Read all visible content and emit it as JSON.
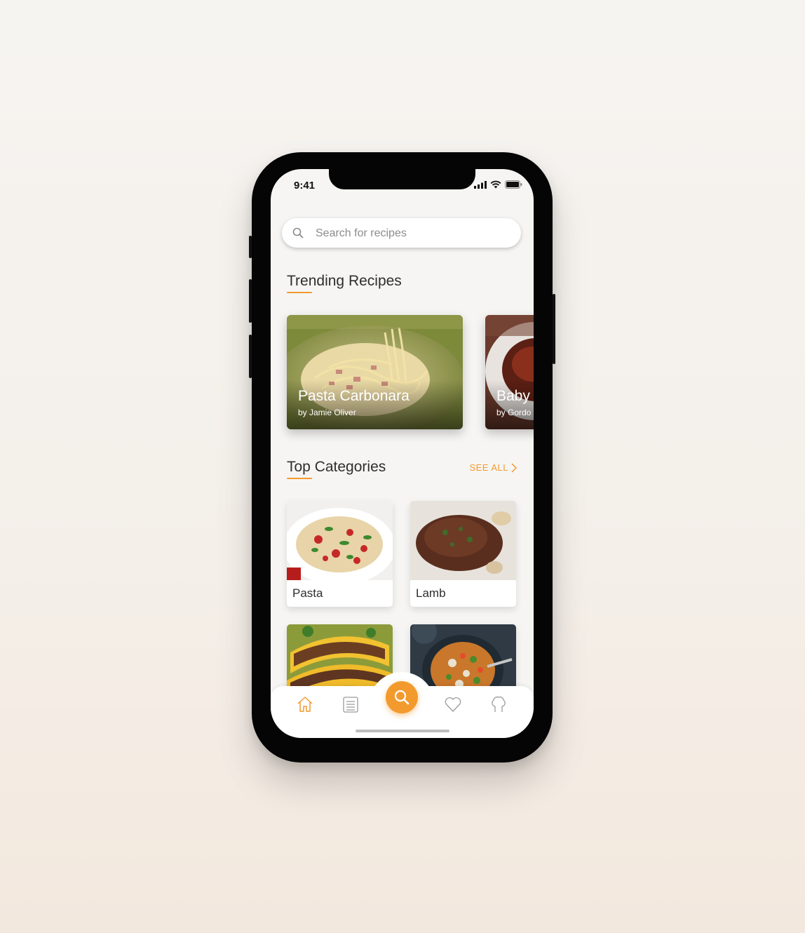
{
  "status_bar": {
    "time": "9:41"
  },
  "search": {
    "placeholder": "Search for recipes"
  },
  "trending": {
    "title": "Trending Recipes",
    "cards": [
      {
        "title": "Pasta Carbonara",
        "author": "by Jamie Oliver"
      },
      {
        "title": "Baby",
        "author": "by Gordo"
      }
    ]
  },
  "categories": {
    "title": "Top Categories",
    "see_all": "SEE ALL",
    "items": [
      {
        "label": "Pasta"
      },
      {
        "label": "Lamb"
      },
      {
        "label": ""
      },
      {
        "label": ""
      }
    ]
  },
  "tab_bar": {
    "items": [
      "home-icon",
      "list-icon",
      "search-icon",
      "heart-icon",
      "chef-hat-icon"
    ],
    "active": "search-icon"
  },
  "colors": {
    "accent": "#f39a2e",
    "background": "#f6f5f3",
    "text": "#2e2e2e"
  }
}
